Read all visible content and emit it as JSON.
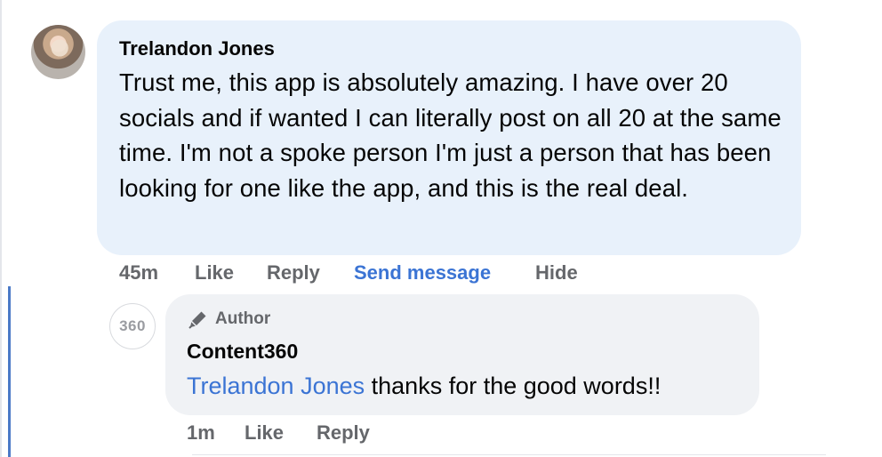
{
  "comment": {
    "author": "Trelandon Jones",
    "text": "Trust me, this app is absolutely amazing. I have over 20 socials and if wanted I can literally post on all 20 at the same time. I'm not a spoke person I'm just a person that has been looking for one like the app, and this is the real deal.",
    "time": "45m",
    "actions": {
      "like": "Like",
      "reply": "Reply",
      "send_message": "Send message",
      "hide": "Hide"
    }
  },
  "reply": {
    "avatar_text": "360",
    "badge": "Author",
    "badge_icon": "pen-icon",
    "author": "Content360",
    "mention": "Trelandon Jones",
    "text": " thanks for the good words!!",
    "time": "1m",
    "actions": {
      "like": "Like",
      "reply": "Reply"
    }
  },
  "colors": {
    "comment_bubble": "#e8f1fb",
    "reply_bubble": "#f0f2f5",
    "link_blue": "#3b74d4",
    "muted_gray": "#65676b",
    "thread_line": "#4b7ac7"
  }
}
